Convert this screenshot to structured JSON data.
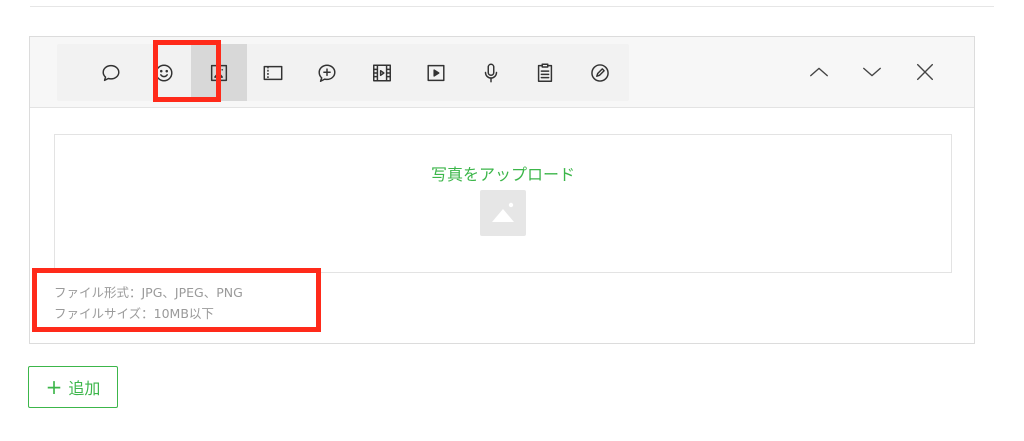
{
  "editor": {
    "toolbar": {
      "tools": [
        {
          "icon": "speech-bubble-icon"
        },
        {
          "icon": "smiley-icon"
        },
        {
          "icon": "image-icon",
          "selected": true
        },
        {
          "icon": "card-icon"
        },
        {
          "icon": "add-message-icon"
        },
        {
          "icon": "film-icon"
        },
        {
          "icon": "play-video-icon"
        },
        {
          "icon": "microphone-icon"
        },
        {
          "icon": "clipboard-icon"
        },
        {
          "icon": "edit-pen-icon"
        }
      ],
      "nav": [
        {
          "icon": "chevron-up-icon"
        },
        {
          "icon": "chevron-down-icon"
        },
        {
          "icon": "close-icon"
        }
      ]
    },
    "upload": {
      "label": "写真をアップロード",
      "icon": "image-placeholder-icon"
    },
    "notes": {
      "file_format": "ファイル形式：JPG、JPEG、PNG",
      "file_size": "ファイルサイズ：10MB以下"
    }
  },
  "add_button": {
    "icon": "plus-icon",
    "label": "追加"
  },
  "colors": {
    "accent": "#3cb64a",
    "highlight": "#ff2a1a",
    "icon": "#333333"
  }
}
